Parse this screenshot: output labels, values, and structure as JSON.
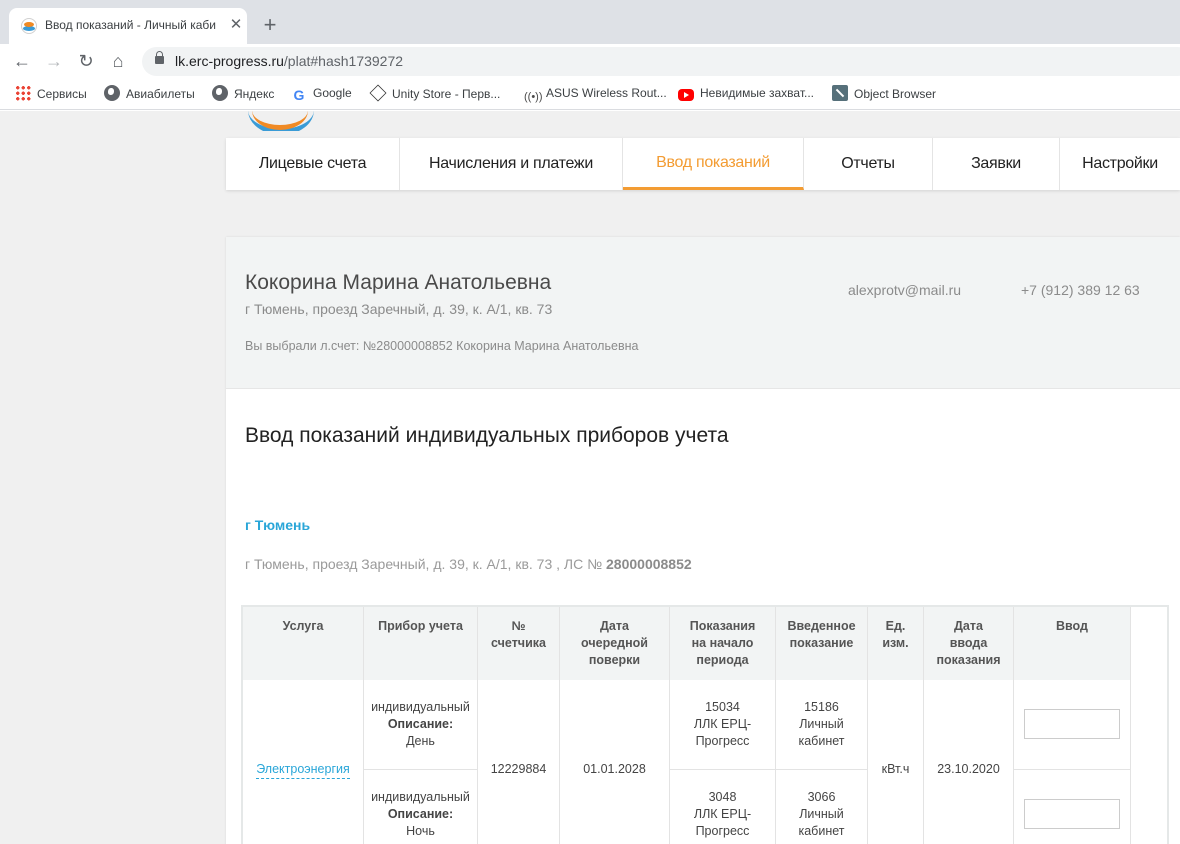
{
  "browser": {
    "tab_title": "Ввод показаний - Личный каби",
    "tab_close": "✕",
    "new_tab": "+",
    "url_host": "lk.erc-progress.ru",
    "url_path": "/plat#hash1739272",
    "bookmarks": [
      {
        "label": "Сервисы",
        "icon": "apps-grid-icon"
      },
      {
        "label": "Авиабилеты",
        "icon": "globe-icon"
      },
      {
        "label": "Яндекс",
        "icon": "globe-icon"
      },
      {
        "label": "Google",
        "icon": "google-icon"
      },
      {
        "label": "Unity Store - Перв...",
        "icon": "unity-icon"
      },
      {
        "label": "ASUS Wireless Rout...",
        "icon": "wireless-icon"
      },
      {
        "label": "Невидимые захват...",
        "icon": "youtube-icon"
      },
      {
        "label": "Object Browser",
        "icon": "object-browser-icon"
      }
    ]
  },
  "nav": {
    "items": [
      "Лицевые счета",
      "Начисления и платежи",
      "Ввод показаний",
      "Отчеты",
      "Заявки",
      "Настройки"
    ],
    "active_index": 2
  },
  "profile": {
    "name": "Кокорина Марина Анатольевна",
    "address": "г Тюмень, проезд Заречный, д. 39, к. А/1, кв. 73",
    "selected_account": "Вы выбрали л.счет: №28000008852 Кокорина Марина Анатольевна",
    "email": "alexprotv@mail.ru",
    "phone": "+7 (912) 389 12 63"
  },
  "section": {
    "title": "Ввод показаний индивидуальных приборов учета",
    "city": "г Тюмень",
    "address_line": "г Тюмень, проезд Заречный, д. 39, к. А/1, кв. 73 , ЛС №",
    "account_number": "28000008852"
  },
  "table": {
    "headers": {
      "service": "Услуга",
      "meter": "Прибор учета",
      "number": "№ счетчика",
      "verification": "Дата очередной поверки",
      "start": "Показания на начало периода",
      "entered": "Введенное показание",
      "unit": "Ед. изм.",
      "date": "Дата ввода показания",
      "input": "Ввод"
    },
    "service": "Электроэнергия",
    "meter_number": "12229884",
    "verification_date": "01.01.2028",
    "unit": "кВт.ч",
    "entry_date": "23.10.2020",
    "description_label": "Описание:",
    "rows": [
      {
        "meter_type": "индивидуальный",
        "description": "День",
        "start_value": "15034",
        "start_source": "ЛЛК ЕРЦ-Прогресс",
        "entered_value": "15186",
        "entered_source": "Личный кабинет",
        "input_value": ""
      },
      {
        "meter_type": "индивидуальный",
        "description": "Ночь",
        "start_value": "3048",
        "start_source": "ЛЛК ЕРЦ-Прогресс",
        "entered_value": "3066",
        "entered_source": "Личный кабинет",
        "input_value": ""
      }
    ]
  },
  "colors": {
    "accent": "#f39c33",
    "link": "#2aa6d8"
  }
}
